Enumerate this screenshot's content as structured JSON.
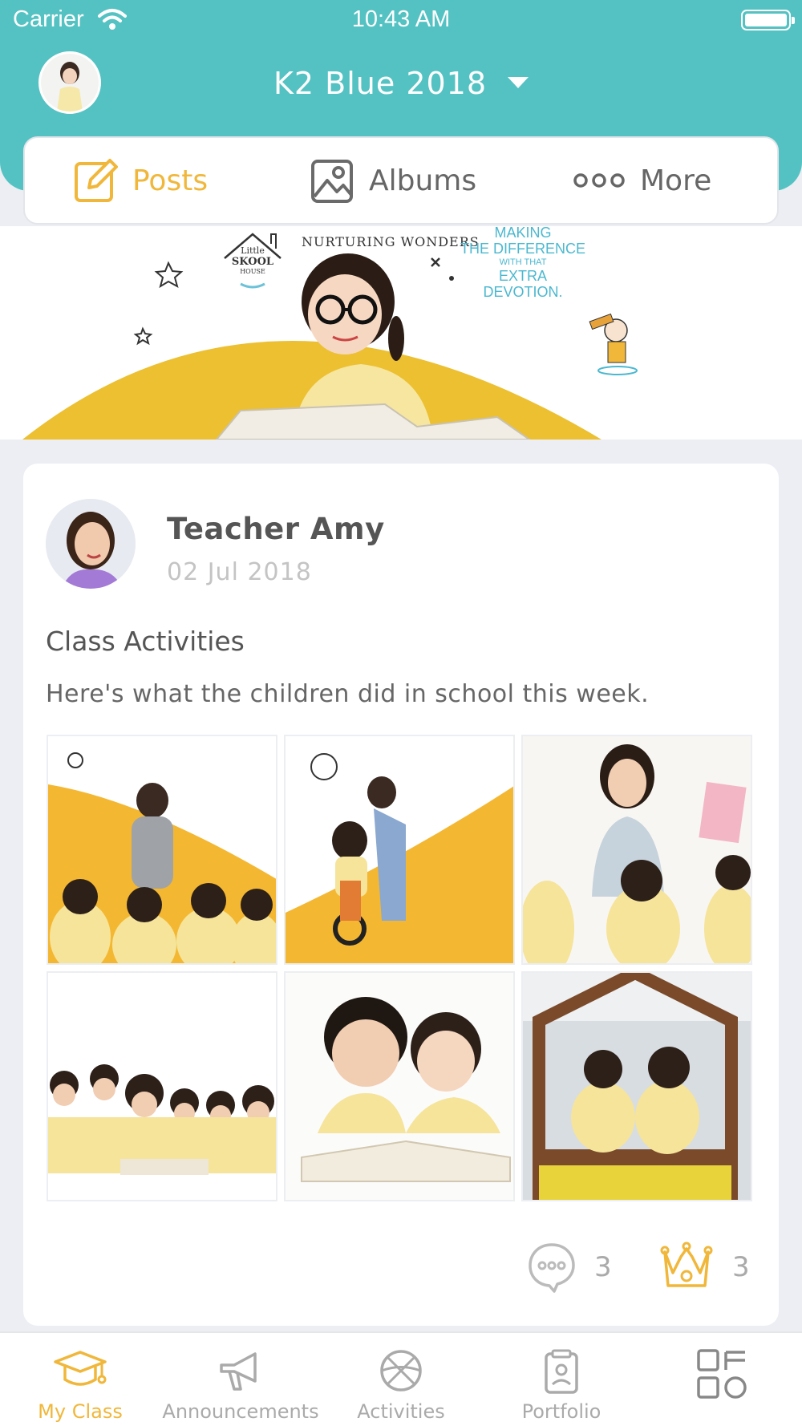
{
  "status_bar": {
    "carrier": "Carrier",
    "time": "10:43 AM"
  },
  "header": {
    "class_name": "K2 Blue 2018"
  },
  "tabs": [
    {
      "label": "Posts",
      "icon": "edit-icon",
      "active": true
    },
    {
      "label": "Albums",
      "icon": "image-icon",
      "active": false
    },
    {
      "label": "More",
      "icon": "more-dots-icon",
      "active": false
    }
  ],
  "banner": {
    "logo_text": [
      "Little",
      "SKOOL",
      "HOUSE"
    ],
    "tagline": "NURTURING WONDERS",
    "slogan": [
      "MAKING",
      "THE DIFFERENCE",
      "WITH THAT",
      "EXTRA",
      "DEVOTION."
    ]
  },
  "post": {
    "author": "Teacher Amy",
    "date": "02 Jul 2018",
    "title": "Class Activities",
    "body": "Here's what the children did in school this week.",
    "photo_count": 6,
    "comments": "3",
    "crowns": "3"
  },
  "nav": [
    {
      "label": "My Class",
      "icon": "graduation-cap-icon",
      "active": true
    },
    {
      "label": "Announcements",
      "icon": "megaphone-icon",
      "active": false
    },
    {
      "label": "Activities",
      "icon": "basketball-icon",
      "active": false
    },
    {
      "label": "Portfolio",
      "icon": "portfolio-icon",
      "active": false
    },
    {
      "label": "",
      "icon": "grid-menu-icon",
      "active": false
    }
  ],
  "colors": {
    "teal": "#54c2c2",
    "accent": "#f0b73a",
    "banner_yellow": "#ecc030"
  }
}
